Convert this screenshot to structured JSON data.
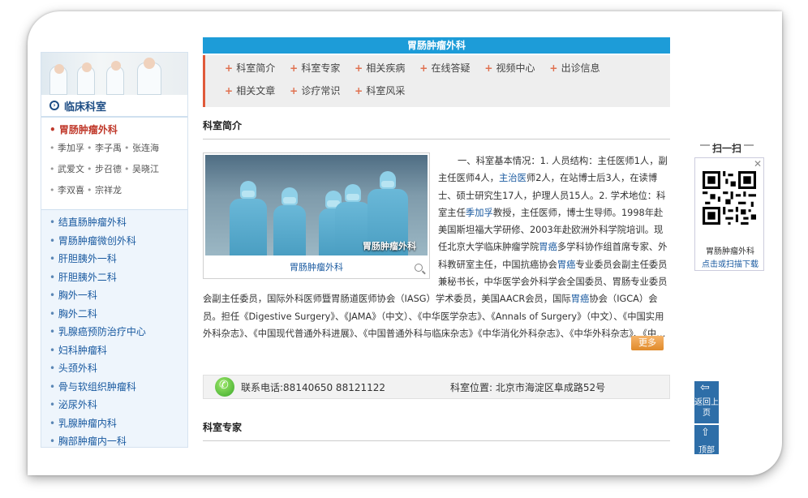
{
  "sidebar": {
    "heading": "临床科室",
    "active_dept": "胃肠肿瘤外科",
    "doctors": [
      "季加孚",
      "李子禹",
      "张连海",
      "武爱文",
      "步召德",
      "吴晓江",
      "李双喜",
      "宗祥龙"
    ],
    "depts": [
      "结直肠肿瘤外科",
      "胃肠肿瘤微创外科",
      "肝胆胰外一科",
      "肝胆胰外二科",
      "胸外一科",
      "胸外二科",
      "乳腺癌预防治疗中心",
      "妇科肿瘤科",
      "头颈外科",
      "骨与软组织肿瘤科",
      "泌尿外科",
      "乳腺肿瘤内科",
      "胸部肿瘤内一科"
    ]
  },
  "main": {
    "title": "胃肠肿瘤外科",
    "nav": [
      "科室简介",
      "科室专家",
      "相关疾病",
      "在线答疑",
      "视频中心",
      "出诊信息",
      "相关文章",
      "诊疗常识",
      "科室风采"
    ],
    "intro_title": "科室简介",
    "photo_caption": "胃肠肿瘤外科",
    "photo_sub": "胃肠肿瘤外科",
    "intro_p1": "一、科室基本情况：1. 人员结构：主任医师1人，副主任医师4人，",
    "intro_link1": "主治医",
    "intro_p2": "师2人，在站博士后3人，在读博士、硕士研究生17人，护理人员15人。2. 学术地位：科室主任",
    "intro_link2": "季加孚",
    "intro_p3": "教授，主任医师，博士生导师。1998年赴美国斯坦福大学研修、2003年赴欧洲外科学院培训。现任北京大学临床肿瘤学院",
    "intro_link3": "胃癌",
    "intro_p4": "多学科协作组首席专家、外科教研室主任，中国抗癌协会",
    "intro_link4": "胃癌",
    "intro_p5": "专业委员会副主任委员兼秘书长，中华医学会外科学会全国委员、胃肠专业委员会副主任委员，国际外科医师暨胃肠道医师协会（IASG）学术委员，美国AACR会员，国际",
    "intro_link5": "胃癌",
    "intro_p6": "协会（IGCA）会员。担任《Digestive Surgery》、《JAMA》（中文）、《中华医学杂志》、《Annals of Surgery》（中文）、《中国实用外科杂志》、《中国现代普通外科进展》、《中国普通外科与临床杂志》《中华消化外科杂志》、《中华外科杂志》、《中…",
    "more_label": "更多",
    "phone": "联系电话:88140650 88121122",
    "location": "科室位置: 北京市海淀区阜成路52号",
    "experts_title": "科室专家"
  },
  "widgets": {
    "scan_title": "扫一扫",
    "qr_name": "胃肠肿瘤外科",
    "qr_link": "点击或扫描下载",
    "back_label": "返回上页",
    "top_label": "顶部"
  },
  "colors": {
    "title_bar": "#1d9cd8",
    "accent": "#e05a3a",
    "link": "#1a5aa0"
  }
}
